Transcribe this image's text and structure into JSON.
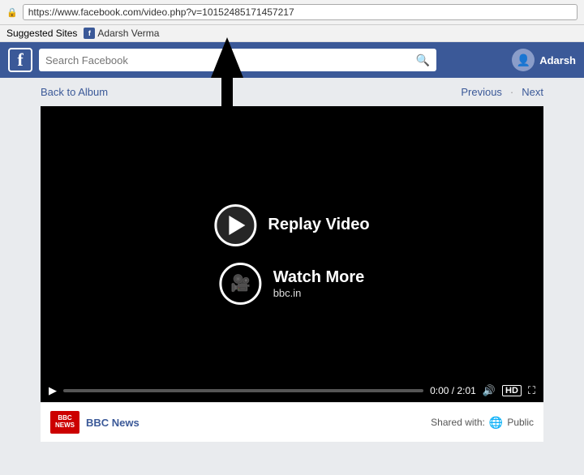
{
  "browser": {
    "url": "https://www.facebook.com/video.php?v=10152485171457217",
    "ssl_label": "https",
    "suggested_sites": "Suggested Sites",
    "bookmark_label": "Adarsh Verma"
  },
  "header": {
    "logo": "f",
    "search_placeholder": "Search Facebook",
    "user_name": "Adarsh"
  },
  "album_nav": {
    "back_label": "Back to Album",
    "previous_label": "Previous",
    "next_label": "Next",
    "separator": "|"
  },
  "video": {
    "replay_label": "Replay Video",
    "watch_label": "Watch More",
    "watch_sub": "bbc.in",
    "time_display": "0:00 / 2:01",
    "hd_label": "HD"
  },
  "post": {
    "bbc_line1": "BBC",
    "bbc_line2": "NEWS",
    "source_name": "BBC News",
    "shared_label": "Shared with:",
    "privacy_label": "Public"
  },
  "arrow": {
    "label": "arrow-up"
  }
}
